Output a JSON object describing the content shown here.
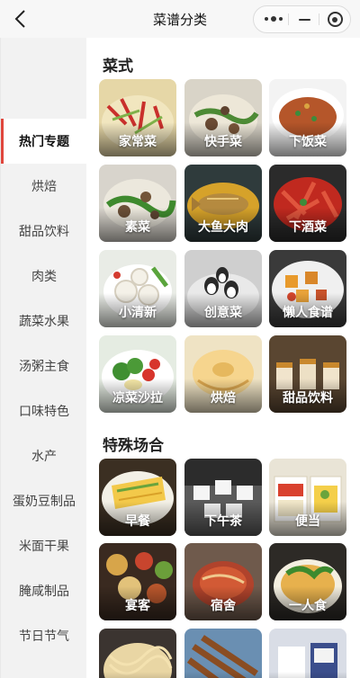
{
  "navbar": {
    "title": "菜谱分类",
    "back_icon": "chevron-left-icon",
    "capsule": [
      "more-dots-icon",
      "minimize-icon",
      "close-target-icon"
    ]
  },
  "sidebar": {
    "active_color": "#e0463c",
    "items": [
      {
        "label": "热门专题",
        "active": true
      },
      {
        "label": "烘焙"
      },
      {
        "label": "甜品饮料"
      },
      {
        "label": "肉类"
      },
      {
        "label": "蔬菜水果"
      },
      {
        "label": "汤粥主食"
      },
      {
        "label": "口味特色"
      },
      {
        "label": "水产"
      },
      {
        "label": "蛋奶豆制品"
      },
      {
        "label": "米面干果"
      },
      {
        "label": "腌咸制品"
      },
      {
        "label": "节日节气"
      }
    ]
  },
  "sections": [
    {
      "title": "菜式",
      "cards": [
        {
          "label": "家常菜"
        },
        {
          "label": "快手菜"
        },
        {
          "label": "下饭菜"
        },
        {
          "label": "素菜"
        },
        {
          "label": "大鱼大肉"
        },
        {
          "label": "下酒菜"
        },
        {
          "label": "小清新"
        },
        {
          "label": "创意菜"
        },
        {
          "label": "懒人食谱"
        },
        {
          "label": "凉菜沙拉"
        },
        {
          "label": "烘焙"
        },
        {
          "label": "甜品饮料"
        }
      ]
    },
    {
      "title": "特殊场合",
      "cards": [
        {
          "label": "早餐"
        },
        {
          "label": "下午茶"
        },
        {
          "label": "便当"
        },
        {
          "label": "宴客"
        },
        {
          "label": "宿舍"
        },
        {
          "label": "一人食"
        },
        {
          "label": ""
        },
        {
          "label": ""
        },
        {
          "label": ""
        }
      ]
    }
  ]
}
